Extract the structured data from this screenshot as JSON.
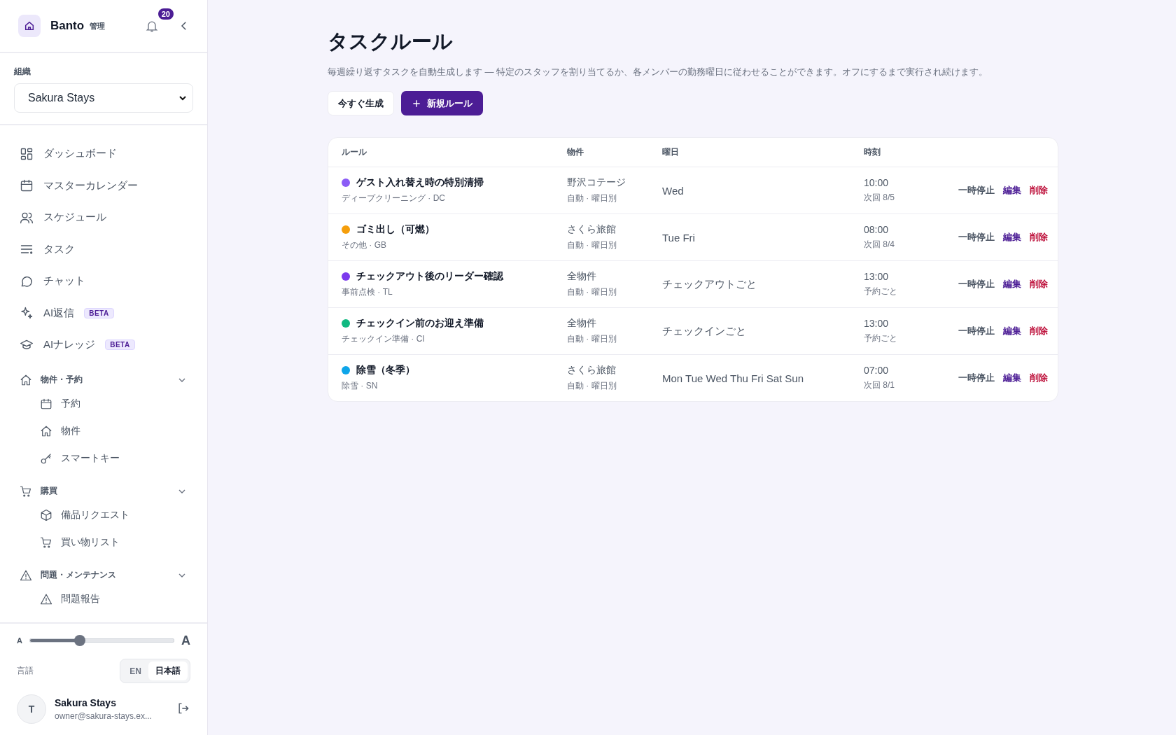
{
  "brand": {
    "name": "Banto",
    "tag": "管理",
    "notifications": "20"
  },
  "org": {
    "label": "組織",
    "value": "Sakura Stays"
  },
  "nav": [
    {
      "label": "ダッシュボード"
    },
    {
      "label": "マスターカレンダー"
    },
    {
      "label": "スケジュール"
    },
    {
      "label": "タスク"
    },
    {
      "label": "チャット"
    },
    {
      "label": "AI返信",
      "badge": "BETA"
    },
    {
      "label": "AIナレッジ",
      "badge": "BETA"
    }
  ],
  "sections": [
    {
      "label": "物件・予約",
      "expanded": true,
      "children": [
        {
          "label": "予約"
        },
        {
          "label": "物件"
        },
        {
          "label": "スマートキー"
        }
      ]
    },
    {
      "label": "購買",
      "expanded": true,
      "children": [
        {
          "label": "備品リクエスト"
        },
        {
          "label": "買い物リスト"
        }
      ]
    },
    {
      "label": "問題・メンテナンス",
      "expanded": true,
      "children": [
        {
          "label": "問題報告"
        }
      ]
    }
  ],
  "font_size": {
    "small": "A",
    "large": "A",
    "level": 0.35
  },
  "language": {
    "label": "言語",
    "options": [
      {
        "label": "EN",
        "selected": false
      },
      {
        "label": "日本語",
        "selected": true
      }
    ]
  },
  "user": {
    "initial": "T",
    "name": "Sakura Stays",
    "email": "owner@sakura-stays.ex..."
  },
  "page": {
    "title": "タスクルール",
    "description": "毎週繰り返すタスクを自動生成します — 特定のスタッフを割り当てるか、各メンバーの勤務曜日に従わせることができます。オフにするまで実行され続けます。",
    "buttons": [
      {
        "label": "今すぐ生成",
        "kind": "secondary"
      },
      {
        "label": "新規ルール",
        "kind": "primary"
      }
    ]
  },
  "table": {
    "columns": [
      "ルール",
      "物件",
      "曜日",
      "時刻"
    ],
    "rows": [
      {
        "name": "ゲスト入れ替え時の特別清掃",
        "color": "#8b5cf6",
        "sub": "ディープクリーニング · DC",
        "property": "野沢コテージ",
        "mode": "自動 · 曜日別",
        "days": "Wed",
        "time": "10:00",
        "next": "次回 8/5",
        "actions": [
          "一時停止",
          "編集",
          "削除"
        ]
      },
      {
        "name": "ゴミ出し（可燃）",
        "color": "#f59e0b",
        "sub": "その他 · GB",
        "property": "さくら旅館",
        "mode": "自動 · 曜日別",
        "days": "Tue Fri",
        "time": "08:00",
        "next": "次回 8/4",
        "actions": [
          "一時停止",
          "編集",
          "削除"
        ]
      },
      {
        "name": "チェックアウト後のリーダー確認",
        "color": "#7c3aed",
        "sub": "事前点検 · TL",
        "property": "全物件",
        "mode": "自動 · 曜日別",
        "days": "チェックアウトごと",
        "time": "13:00",
        "next": "予約ごと",
        "actions": [
          "一時停止",
          "編集",
          "削除"
        ]
      },
      {
        "name": "チェックイン前のお迎え準備",
        "color": "#10b981",
        "sub": "チェックイン準備 · CI",
        "property": "全物件",
        "mode": "自動 · 曜日別",
        "days": "チェックインごと",
        "time": "13:00",
        "next": "予約ごと",
        "actions": [
          "一時停止",
          "編集",
          "削除"
        ]
      },
      {
        "name": "除雪（冬季）",
        "color": "#0ea5e9",
        "sub": "除雪 · SN",
        "property": "さくら旅館",
        "mode": "自動 · 曜日別",
        "days": "Mon Tue Wed Thu Fri Sat Sun",
        "time": "07:00",
        "next": "次回 8/1",
        "actions": [
          "一時停止",
          "編集",
          "削除"
        ]
      }
    ]
  }
}
